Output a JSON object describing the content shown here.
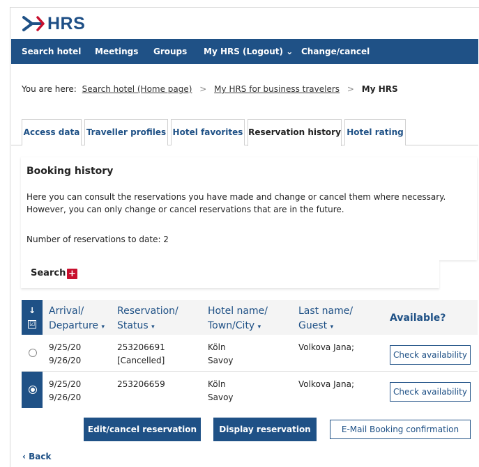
{
  "brand": {
    "logo_text": "HRS",
    "color": "#1f5186",
    "accent": "#c8102e"
  },
  "nav": {
    "items": [
      {
        "label": "Search hotel"
      },
      {
        "label": "Meetings"
      },
      {
        "label": "Groups"
      },
      {
        "label": "My HRS (Logout) ⌄"
      },
      {
        "label": "Change/cancel"
      }
    ]
  },
  "breadcrumb": {
    "prefix": "You are here:",
    "links": [
      "Search hotel (Home page)",
      "My HRS for business travelers"
    ],
    "separator": ">",
    "current": "My HRS"
  },
  "tabs": [
    {
      "label": "Access data"
    },
    {
      "label": "Traveller profiles"
    },
    {
      "label": "Hotel favorites"
    },
    {
      "label": "Reservation history",
      "active": true
    },
    {
      "label": "Hotel rating"
    }
  ],
  "booking": {
    "title": "Booking history",
    "text": "Here you can consult the reservations you have made and change or cancel them where necessary. However, you can only change or cancel reservations that are in the future.",
    "count_text": "Number of reservations to date: 2"
  },
  "search": {
    "label": "Search",
    "toggle_icon": "+"
  },
  "table": {
    "headers": {
      "sort_icon": "↓",
      "select_all_icon": "☑",
      "arrival": "Arrival/",
      "departure": "Departure",
      "reservation": "Reservation/",
      "status": "Status",
      "hotel": "Hotel name/",
      "town": "Town/City",
      "lastname": "Last name/",
      "guest": "Guest",
      "available": "Available?",
      "caret": "▾"
    },
    "rows": [
      {
        "arrival": "9/25/20",
        "departure": "9/26/20",
        "reservation": "253206691",
        "status": "[Cancelled]",
        "town": "Köln",
        "hotel": "Savoy",
        "guest": "Volkova Jana;",
        "action": "Check availability",
        "selected": false
      },
      {
        "arrival": "9/25/20",
        "departure": "9/26/20",
        "reservation": "253206659",
        "status": "",
        "town": "Köln",
        "hotel": "Savoy",
        "guest": "Volkova Jana;",
        "action": "Check availability",
        "selected": true
      }
    ]
  },
  "actions": {
    "edit": "Edit/cancel reservation",
    "display": "Display reservation",
    "email": "E-Mail Booking confirmation"
  },
  "back": "‹ Back"
}
